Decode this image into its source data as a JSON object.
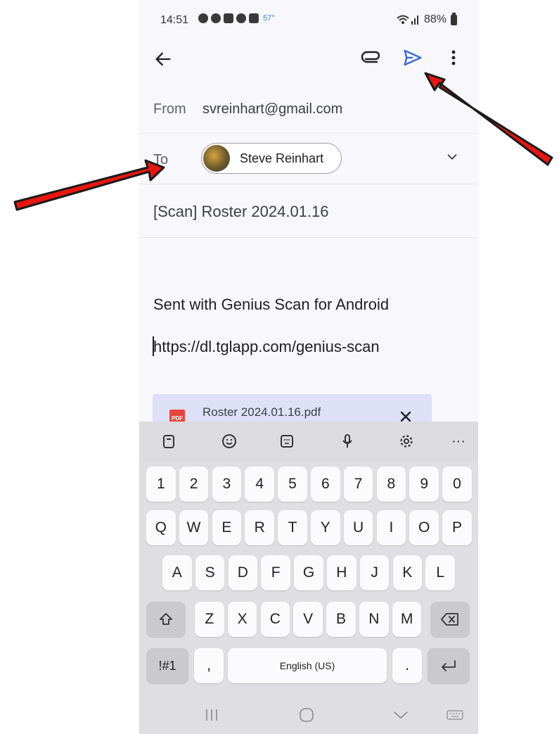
{
  "status_bar": {
    "time": "14:51",
    "temperature": "57°",
    "battery": "88%",
    "icons": [
      "message-icon",
      "pinterest-icon",
      "ring-icon",
      "location-icon",
      "image-icon"
    ]
  },
  "app_bar": {
    "icons": [
      "back-arrow-icon",
      "paperclip-icon",
      "send-icon",
      "more-vert-icon"
    ],
    "send_color": "#3b6ad8"
  },
  "compose": {
    "from_label": "From",
    "from_value": "svreinhart@gmail.com",
    "to_label": "To",
    "recipient_name": "Steve Reinhart",
    "subject": "[Scan] Roster 2024.01.16",
    "body_line1": "Sent with Genius Scan for Android",
    "body_line2": "https://dl.tglapp.com/genius-scan",
    "attachment_name": "Roster 2024.01.16.pdf",
    "attachment_type": "PDF"
  },
  "keyboard": {
    "toolbar_more": "···",
    "row_numbers": [
      "1",
      "2",
      "3",
      "4",
      "5",
      "6",
      "7",
      "8",
      "9",
      "0"
    ],
    "row_top": [
      "Q",
      "W",
      "E",
      "R",
      "T",
      "Y",
      "U",
      "I",
      "O",
      "P"
    ],
    "row_middle": [
      "A",
      "S",
      "D",
      "F",
      "G",
      "H",
      "J",
      "K",
      "L"
    ],
    "row_bottom": [
      "Z",
      "X",
      "C",
      "V",
      "B",
      "N",
      "M"
    ],
    "symbols_key": "!#1",
    "comma_key": ",",
    "space_label": "English (US)",
    "period_key": "."
  },
  "colors": {
    "annotation_arrow": "#e8160f",
    "attachment_bg": "#dde0f7"
  }
}
